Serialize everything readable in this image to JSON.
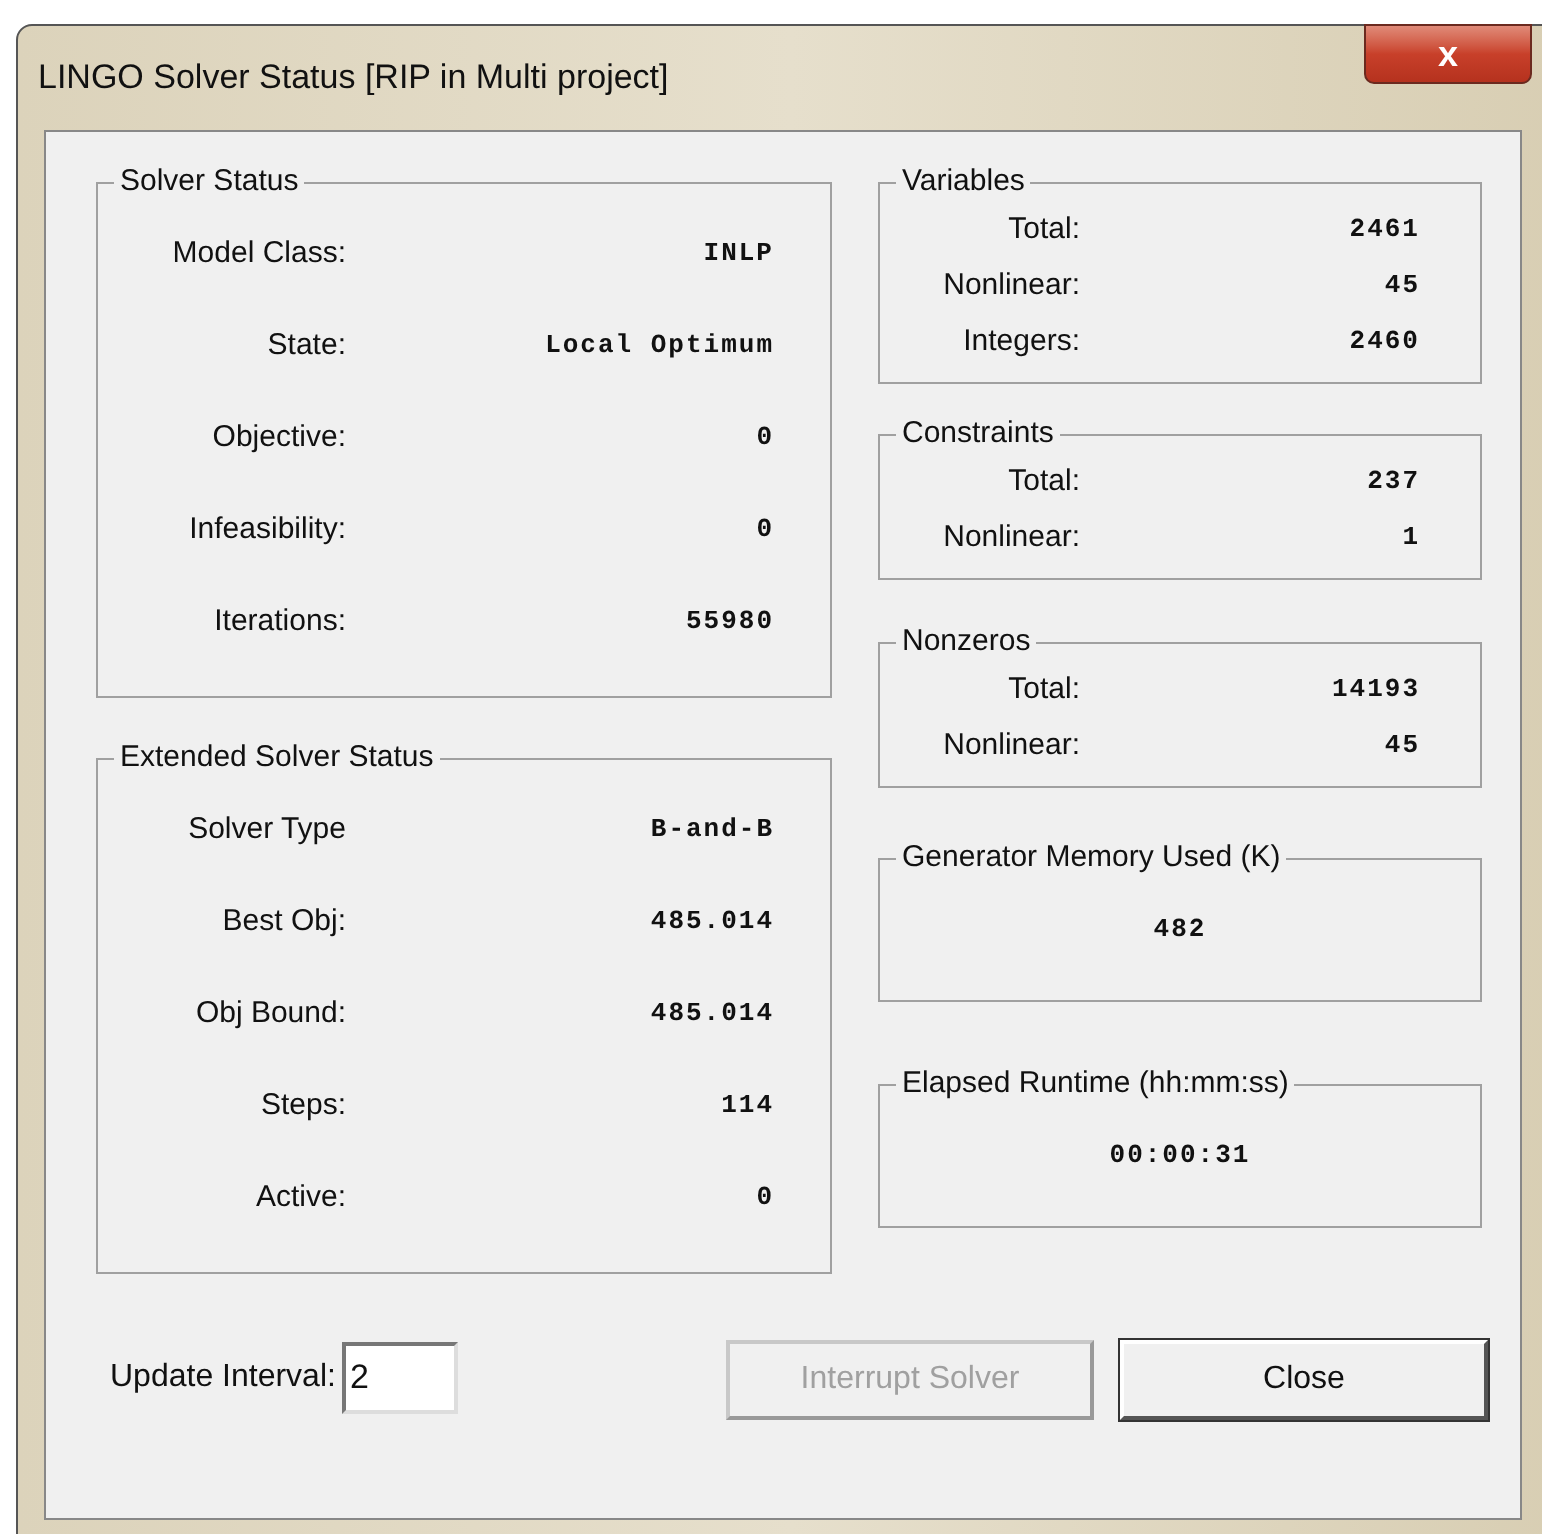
{
  "window": {
    "title": "LINGO Solver Status [RIP in Multi project]",
    "close_button": "x"
  },
  "left_groups": [
    {
      "title": "Solver Status",
      "rows": [
        {
          "label": "Model Class:",
          "value": "INLP"
        },
        {
          "label": "State:",
          "value": "Local Optimum"
        },
        {
          "label": "Objective:",
          "value": "0"
        },
        {
          "label": "Infeasibility:",
          "value": "0"
        },
        {
          "label": "Iterations:",
          "value": "55980"
        }
      ]
    },
    {
      "title": "Extended Solver Status",
      "rows": [
        {
          "label": "Solver Type",
          "value": "B-and-B"
        },
        {
          "label": "Best Obj:",
          "value": "485.014"
        },
        {
          "label": "Obj Bound:",
          "value": "485.014"
        },
        {
          "label": "Steps:",
          "value": "114"
        },
        {
          "label": "Active:",
          "value": "0"
        }
      ]
    }
  ],
  "right_groups": [
    {
      "kind": "table",
      "title": "Variables",
      "rows": [
        {
          "label": "Total:",
          "value": "2461"
        },
        {
          "label": "Nonlinear:",
          "value": "45"
        },
        {
          "label": "Integers:",
          "value": "2460"
        }
      ]
    },
    {
      "kind": "table",
      "title": "Constraints",
      "rows": [
        {
          "label": "Total:",
          "value": "237"
        },
        {
          "label": "Nonlinear:",
          "value": "1"
        }
      ]
    },
    {
      "kind": "table",
      "title": "Nonzeros",
      "rows": [
        {
          "label": "Total:",
          "value": "14193"
        },
        {
          "label": "Nonlinear:",
          "value": "45"
        }
      ]
    },
    {
      "kind": "single",
      "title": "Generator Memory Used (K)",
      "value": "482"
    },
    {
      "kind": "single",
      "title": "Elapsed Runtime (hh:mm:ss)",
      "value": "00:00:31"
    }
  ],
  "update_interval": {
    "label": "Update Interval:",
    "value": "2"
  },
  "buttons": [
    {
      "label": "Interrupt Solver",
      "disabled": true
    },
    {
      "label": "Close",
      "disabled": false
    }
  ]
}
